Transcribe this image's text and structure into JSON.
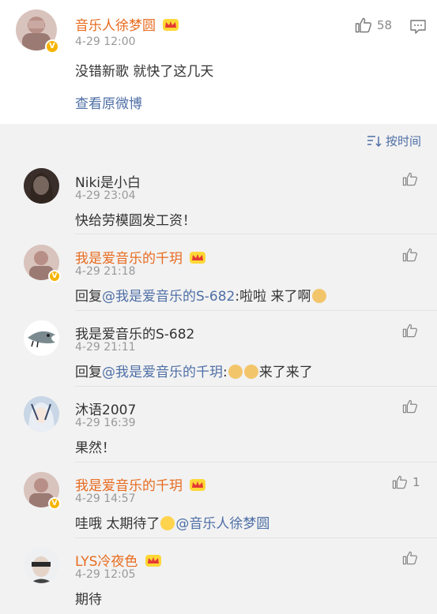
{
  "post": {
    "author": "音乐人徐梦圆",
    "time": "4-29 12:00",
    "text": "没错新歌 就快了这几天",
    "view_original": "查看原微博",
    "like_count": "58"
  },
  "sort_label": "按时间",
  "comments": [
    {
      "name": "Niki是小白",
      "time": "4-29 23:04",
      "text": "快给劳模圆发工资！"
    },
    {
      "name": "我是爱音乐的千玥",
      "time": "4-29 21:18",
      "prefix": "回复",
      "mention": "@我是爱音乐的S-682",
      "suffix": ":啦啦 来了啊"
    },
    {
      "name": "我是爱音乐的S-682",
      "time": "4-29 21:11",
      "prefix": "回复",
      "mention": "@我是爱音乐的千玥",
      "suffix1": ":",
      "suffix2": "来了来了"
    },
    {
      "name": "沐语2007",
      "time": "4-29 16:39",
      "text": "果然！"
    },
    {
      "name": "我是爱音乐的千玥",
      "time": "4-29 14:57",
      "text": "哇哦 太期待了",
      "mention": "@音乐人徐梦圆",
      "like_count": "1"
    },
    {
      "name": "LYS冷夜色",
      "time": "4-29 12:05",
      "text": "期待"
    }
  ],
  "colors": {
    "accent_orange": "#e86b1f",
    "link_blue": "#4e6fa6",
    "vip_gold": "#f6b400"
  },
  "icons": [
    "thumbs-up-icon",
    "comment-icon",
    "sort-icon",
    "crown-icon",
    "verified-icon"
  ]
}
